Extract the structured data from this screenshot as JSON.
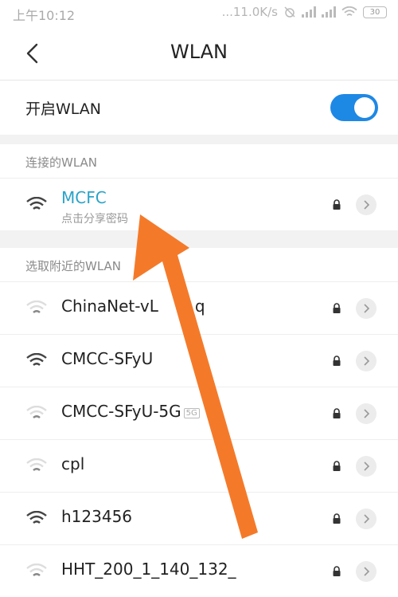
{
  "status": {
    "time": "上午10:12",
    "speed": "...11.0K/s",
    "battery": "30"
  },
  "header": {
    "title": "WLAN"
  },
  "toggle": {
    "label": "开启WLAN",
    "on": true
  },
  "connected": {
    "section_label": "连接的WLAN",
    "ssid": "MCFC",
    "subtitle": "点击分享密码"
  },
  "nearby": {
    "section_label": "选取附近的WLAN",
    "networks": [
      {
        "ssid": "ChinaNet-vL",
        "suffix": "q"
      },
      {
        "ssid": "CMCC-SFyU",
        "suffix": ""
      },
      {
        "ssid": "CMCC-SFyU-5G",
        "suffix": "",
        "badge": "5G"
      },
      {
        "ssid": "cpl",
        "suffix": ""
      },
      {
        "ssid": "h123456",
        "suffix": ""
      },
      {
        "ssid": "HHT_200_1_140_132_",
        "suffix": ""
      }
    ]
  },
  "colors": {
    "accent": "#1e88e5",
    "connected_text": "#2aa4c8",
    "annotation_arrow": "#f47a2a"
  }
}
